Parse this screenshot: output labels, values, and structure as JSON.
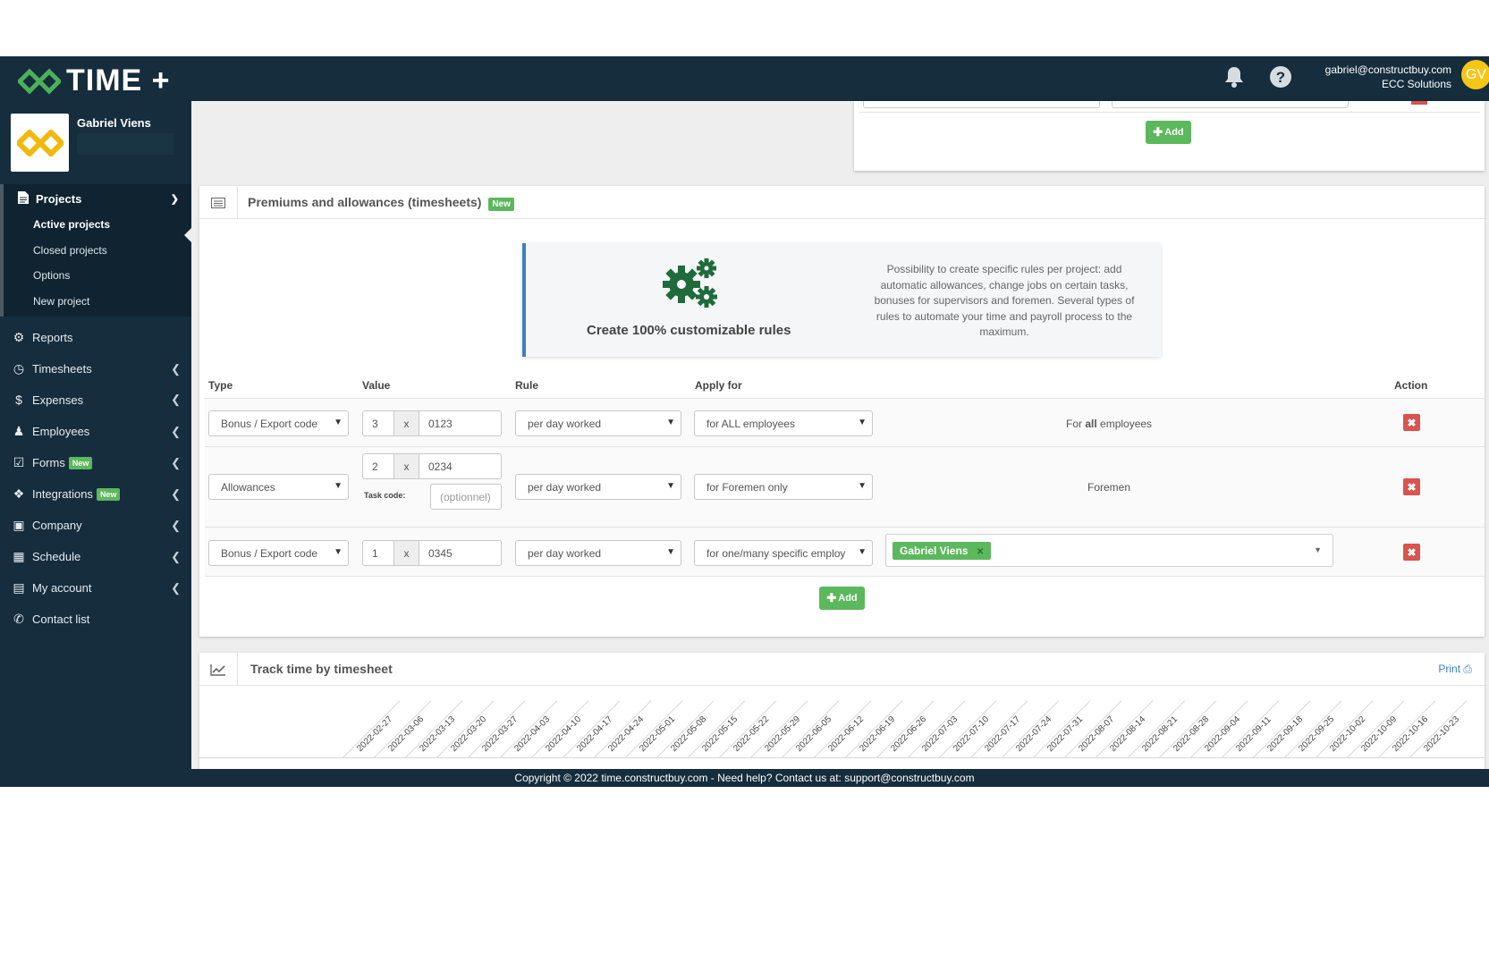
{
  "app": {
    "brand": "TIME +",
    "user_email": "gabriel@constructbuy.com",
    "company": "ECC Solutions",
    "avatar_initials": "GV",
    "colors": {
      "navy": "#152d3d",
      "green": "#5cb85c",
      "red": "#d9534f",
      "gold": "#f5c518",
      "blue_link": "#3a7fc1"
    }
  },
  "sidebar": {
    "profile_name": "Gabriel Viens",
    "projects": {
      "label": "Projects",
      "items": [
        "Active projects",
        "Closed projects",
        "Options",
        "New project"
      ]
    },
    "items": [
      {
        "label": "Reports",
        "icon": "cogs-icon"
      },
      {
        "label": "Timesheets",
        "icon": "clock-icon"
      },
      {
        "label": "Expenses",
        "icon": "dollar-icon"
      },
      {
        "label": "Employees",
        "icon": "users-icon"
      },
      {
        "label": "Forms",
        "icon": "check-square-icon",
        "badge": "New"
      },
      {
        "label": "Integrations",
        "icon": "puzzle-icon",
        "badge": "New"
      },
      {
        "label": "Company",
        "icon": "briefcase-icon"
      },
      {
        "label": "Schedule",
        "icon": "calendar-icon"
      },
      {
        "label": "My account",
        "icon": "id-card-icon"
      },
      {
        "label": "Contact list",
        "icon": "phone-icon"
      }
    ]
  },
  "top_card": {
    "add_label": "Add"
  },
  "premiums": {
    "title": "Premiums and allowances (timesheets)",
    "badge": "New",
    "callout_title": "Create 100% customizable rules",
    "callout_text": "Possibility to create specific rules per project: add automatic allowances, change jobs on certain tasks, bonuses for supervisors and foremen. Several types of rules to automate your time and payroll process to the maximum.",
    "columns": {
      "type": "Type",
      "value": "Value",
      "rule": "Rule",
      "apply_for": "Apply for",
      "action": "Action"
    },
    "rows": [
      {
        "type": "Bonus / Export code",
        "qty": "3",
        "x": "x",
        "code": "0123",
        "rule": "per day worked",
        "apply": "for ALL employees",
        "apply_text_prefix": "For ",
        "apply_text_bold": "all",
        "apply_text_suffix": " employees"
      },
      {
        "type": "Allowances",
        "qty": "2",
        "x": "x",
        "code": "0234",
        "task_code_label": "Task code:",
        "task_code_placeholder": "(optionnel)",
        "rule": "per day worked",
        "apply": "for Foremen only",
        "apply_text": "Foremen"
      },
      {
        "type": "Bonus / Export code",
        "qty": "1",
        "x": "x",
        "code": "0345",
        "rule": "per day worked",
        "apply": "for one/many specific employ",
        "tag": "Gabriel Viens"
      }
    ],
    "add_label": "Add"
  },
  "track": {
    "title": "Track time by timesheet",
    "print_label": "Print",
    "dates": [
      "2022-02-27",
      "2022-03-06",
      "2022-03-13",
      "2022-03-20",
      "2022-03-27",
      "2022-04-03",
      "2022-04-10",
      "2022-04-17",
      "2022-04-24",
      "2022-05-01",
      "2022-05-08",
      "2022-05-15",
      "2022-05-22",
      "2022-05-29",
      "2022-06-05",
      "2022-06-12",
      "2022-06-19",
      "2022-06-26",
      "2022-07-03",
      "2022-07-10",
      "2022-07-17",
      "2022-07-24",
      "2022-07-31",
      "2022-08-07",
      "2022-08-14",
      "2022-08-21",
      "2022-08-28",
      "2022-09-04",
      "2022-09-11",
      "2022-09-18",
      "2022-09-25",
      "2022-10-02",
      "2022-10-09",
      "2022-10-16",
      "2022-10-23"
    ]
  },
  "footer": {
    "text": "Copyright © 2022 time.constructbuy.com - Need help? Contact us at: support@constructbuy.com"
  }
}
